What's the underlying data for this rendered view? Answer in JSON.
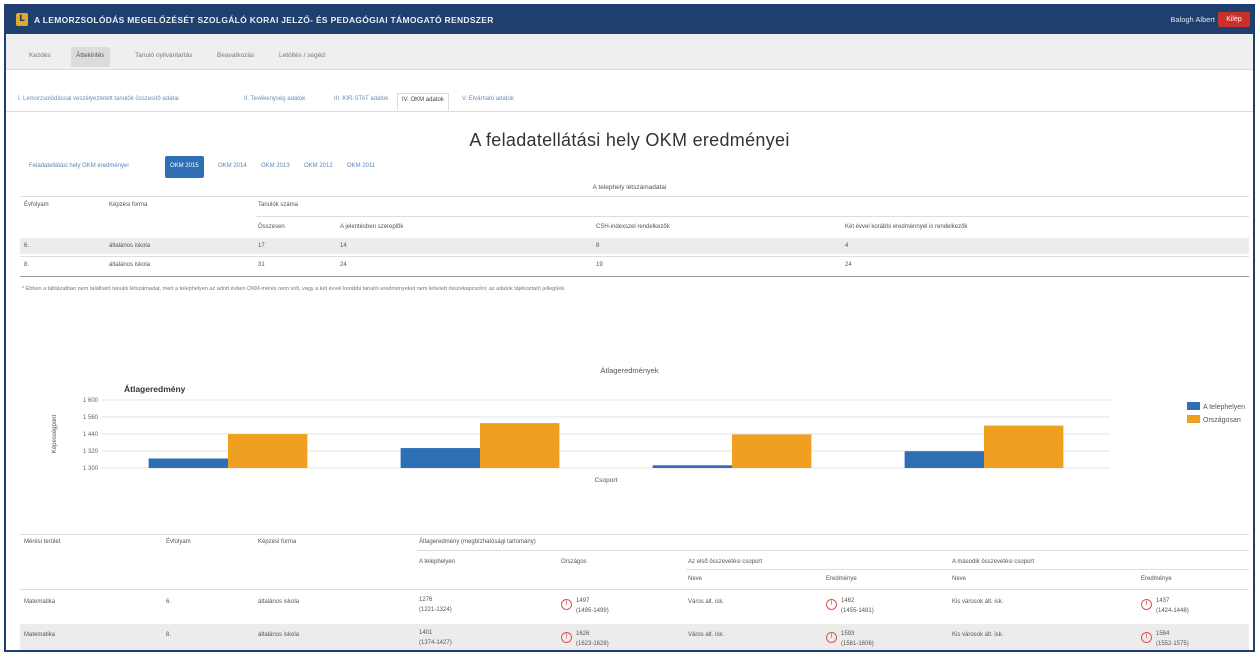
{
  "header": {
    "logo_letter": "L",
    "title": "A LEMORZSOLÓDÁS MEGELŐZÉSÉT SZOLGÁLÓ KORAI JELZŐ- ÉS PEDAGÓGIAI TÁMOGATÓ RENDSZER",
    "user": "Balogh Albert",
    "logout": "Kilép"
  },
  "nav": {
    "items": [
      "Kezdés",
      "Áttekintés",
      "Tanuló nyilvántartás",
      "Beavatkozás",
      "Letöltés / segéd"
    ]
  },
  "subnav": {
    "items": [
      "I. Lemorzsolódással veszélyeztetett tanulók összesítő adatai",
      "II. Tevékenység adatok",
      "III. KIR-STAT adatok",
      "IV. OKM adatok",
      "V. Elvárható adatok"
    ]
  },
  "page": {
    "title": "A feladatellátási hely OKM eredményei"
  },
  "year_tabs": [
    "Feladatellátási hely OKM eredményei",
    "OKM 2015",
    "OKM 2014",
    "OKM 2013",
    "OKM 2012",
    "OKM 2011"
  ],
  "site_table": {
    "title": "A telephely létszámadatai",
    "headers": {
      "grade": "Évfolyam",
      "type": "Képzési forma",
      "count": "Tanulók száma",
      "total": "Összesen",
      "col1": "A jelentésben szereplők",
      "col2": "CSH-indexszel rendelkezők",
      "col3": "Két évvel korábbi eredménnyel is rendelkezők"
    },
    "rows": [
      {
        "grade": "6.",
        "type": "általános iskola",
        "total": "17",
        "c1": "14",
        "c2": "8",
        "c3": "4"
      },
      {
        "grade": "8.",
        "type": "általános iskola",
        "total": "31",
        "c1": "24",
        "c2": "19",
        "c3": "24"
      }
    ],
    "footnote": "* Ebben a táblázatban nem található tanulói létszámadat, mert a telephelyen az adott évben OKM-mérés nem volt, vagy a két évvel korábbi tanulói eredményeket nem lehetett összekapcsolni; az adatok tájékoztató jellegűek."
  },
  "chart_data": {
    "type": "bar",
    "title": "Átlageredmények",
    "inner_title": "Átlageredmény",
    "ylabel": "Képességpont",
    "xlabel": "Csoport",
    "ylim": [
      1300,
      1600
    ],
    "yticks": [
      "1 600",
      "1 560",
      "1 440",
      "1 320",
      "1 300"
    ],
    "categories": [
      "",
      "",
      "",
      ""
    ],
    "series": [
      {
        "name": "A telephelyen",
        "color": "#2f6fb6",
        "values": [
          1342,
          1388,
          1312,
          1374
        ]
      },
      {
        "name": "Országosan",
        "color": "#f0a020",
        "values": [
          1450,
          1498,
          1448,
          1487
        ]
      }
    ]
  },
  "results_table": {
    "headers": {
      "area": "Mérési terület",
      "grade": "Évfolyam",
      "type": "Képzési forma",
      "group": "Átlageredmény (megbízhatósági tartomány)",
      "site": "A telephelyen",
      "national": "Országos",
      "first_group": "Az első összevetési csoport",
      "second_group": "A második összevetési csoport",
      "name": "Neve",
      "result": "Eredménye"
    },
    "rows": [
      {
        "area": "Matematika",
        "grade": "6.",
        "type": "általános iskola",
        "site": "1276",
        "site_range": "(1221-1324)",
        "national": "1497",
        "national_range": "(1495-1499)",
        "g1_name": "Város alt. isk.",
        "g1_result": "1462",
        "g1_range": "(1455-1481)",
        "g2_name": "Kis városok ált. isk.",
        "g2_result": "1437",
        "g2_range": "(1424-1448)"
      },
      {
        "area": "Matematika",
        "grade": "8.",
        "type": "általános iskola",
        "site": "1401",
        "site_range": "(1374-1427)",
        "national": "1626",
        "national_range": "(1623-1628)",
        "g1_name": "Város alt. isk.",
        "g1_result": "1593",
        "g1_range": "(1581-1606)",
        "g2_name": "Kis városok ált. isk.",
        "g2_result": "1564",
        "g2_range": "(1552-1575)"
      }
    ]
  },
  "colors": {
    "header_bg": "#1f3f6e",
    "accent": "#2f6fb6",
    "orange": "#f0a020",
    "warning": "#d9534f"
  }
}
